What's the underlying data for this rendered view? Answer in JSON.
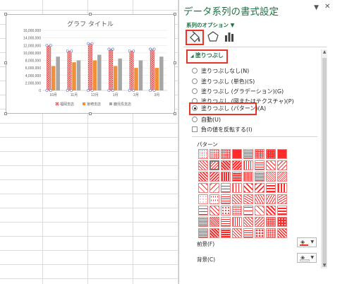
{
  "chart": {
    "title": "グラフ タイトル",
    "legend": [
      "福岡支店",
      "宮崎支店",
      "鹿児島支店"
    ],
    "colors": [
      "#e84545",
      "#f0913a",
      "#a6a6a6"
    ]
  },
  "chart_data": {
    "type": "bar",
    "title": "グラフ タイトル",
    "categories": [
      "10月",
      "11月",
      "12月",
      "1月",
      "2月",
      "3月"
    ],
    "series": [
      {
        "name": "福岡支店",
        "values": [
          12000000,
          10500000,
          12500000,
          11000000,
          10500000,
          11000000
        ]
      },
      {
        "name": "宮崎支店",
        "values": [
          6500000,
          7500000,
          8000000,
          6500000,
          6000000,
          6000000
        ]
      },
      {
        "name": "鹿児島支店",
        "values": [
          9000000,
          8000000,
          9500000,
          8500000,
          8000000,
          9000000
        ]
      }
    ],
    "yticks": [
      "0",
      "2,000,000",
      "4,000,000",
      "6,000,000",
      "8,000,000",
      "10,000,000",
      "12,000,000",
      "14,000,000",
      "16,000,000"
    ],
    "ylim": [
      0,
      16000000
    ],
    "legend_position": "bottom"
  },
  "pane": {
    "title": "データ系列の書式設定",
    "series_options": "系列のオプション",
    "section": "塗りつぶし",
    "options": [
      {
        "label": "塗りつぶしなし(N)",
        "type": "radio",
        "checked": false
      },
      {
        "label": "塗りつぶし (単色)(S)",
        "type": "radio",
        "checked": false
      },
      {
        "label": "塗りつぶし (グラデーション)(G)",
        "type": "radio",
        "checked": false
      },
      {
        "label": "塗りつぶし (図またはテクスチャ)(P)",
        "type": "radio",
        "checked": false
      },
      {
        "label": "塗りつぶし (パターン)(A)",
        "type": "radio",
        "checked": true
      },
      {
        "label": "自動(U)",
        "type": "radio",
        "checked": false
      },
      {
        "label": "負の値を反転する(I)",
        "type": "checkbox",
        "checked": false
      }
    ],
    "pattern_label": "パターン",
    "foreground_label": "前景(F)",
    "background_label": "背景(C)",
    "foreground_color": "#e8352a",
    "background_color": "#ffffff"
  }
}
